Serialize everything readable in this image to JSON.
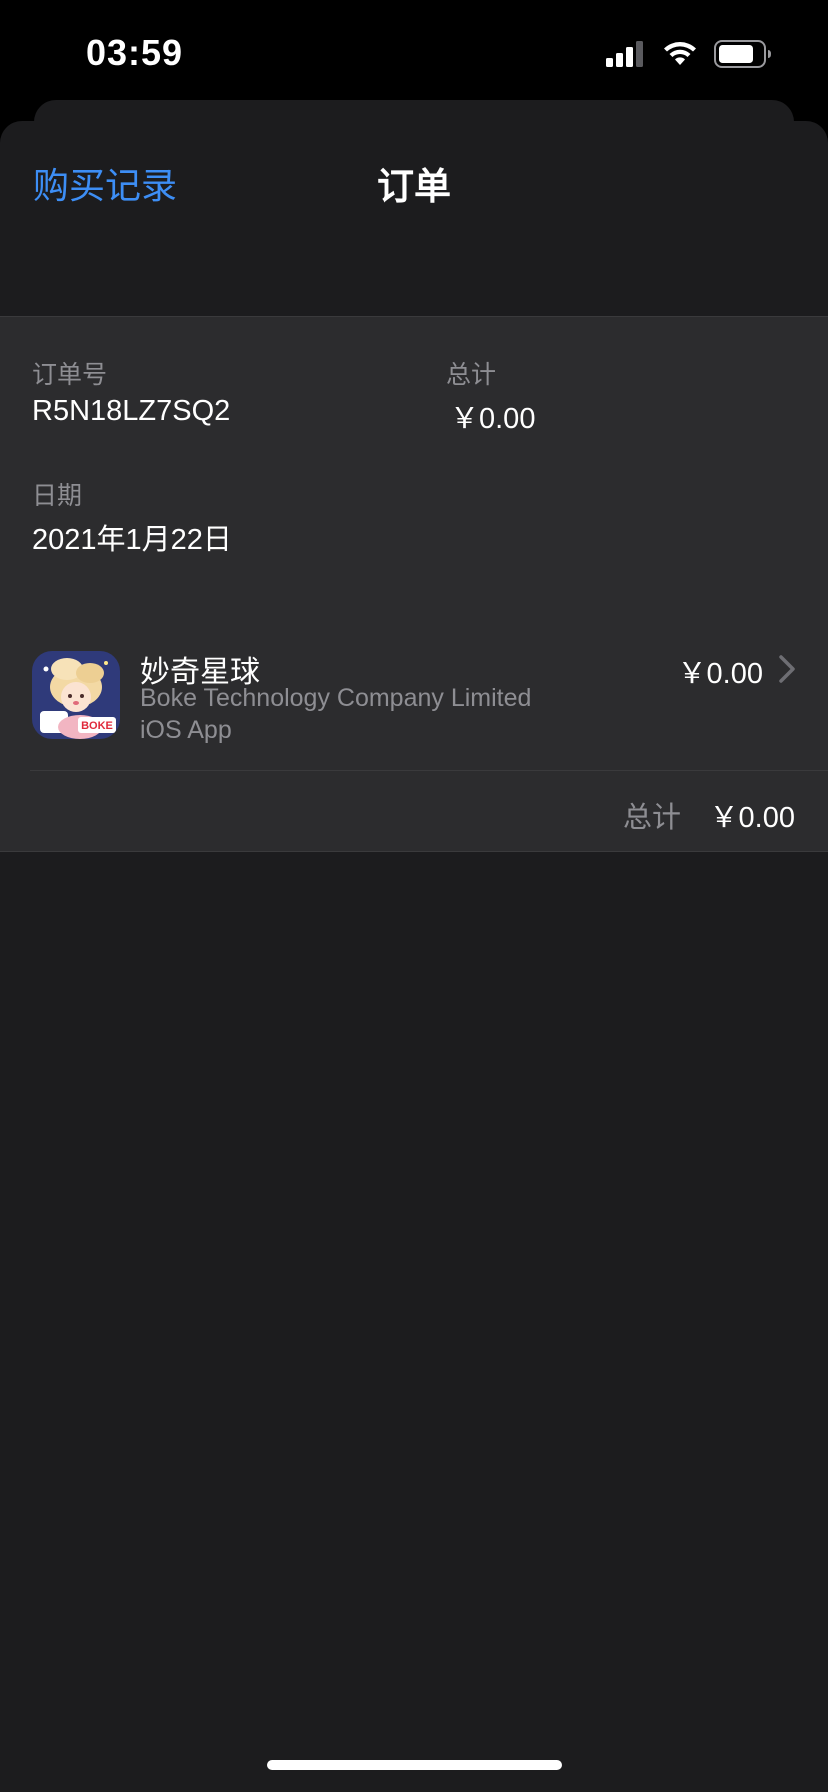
{
  "status_bar": {
    "time": "03:59",
    "icons": [
      "cellular-signal-icon",
      "wifi-icon",
      "battery-icon"
    ]
  },
  "nav": {
    "back_label": "购买记录",
    "title": "订单"
  },
  "order": {
    "number_label": "订单号",
    "number_value": "R5N18LZ7SQ2",
    "total_label": "总计",
    "total_value": "￥0.00",
    "date_label": "日期",
    "date_value": "2021年1月22日"
  },
  "item": {
    "name": "妙奇星球",
    "developer": "Boke Technology Company Limited",
    "kind": "iOS App",
    "price": "￥0.00",
    "icon": "app-icon-boke"
  },
  "summary": {
    "total_label": "总计",
    "total_value": "￥0.00"
  },
  "colors": {
    "accent": "#3d8ef5",
    "background": "#1c1c1e",
    "panel": "#2c2c2e",
    "secondary_text": "#8e8e93"
  }
}
